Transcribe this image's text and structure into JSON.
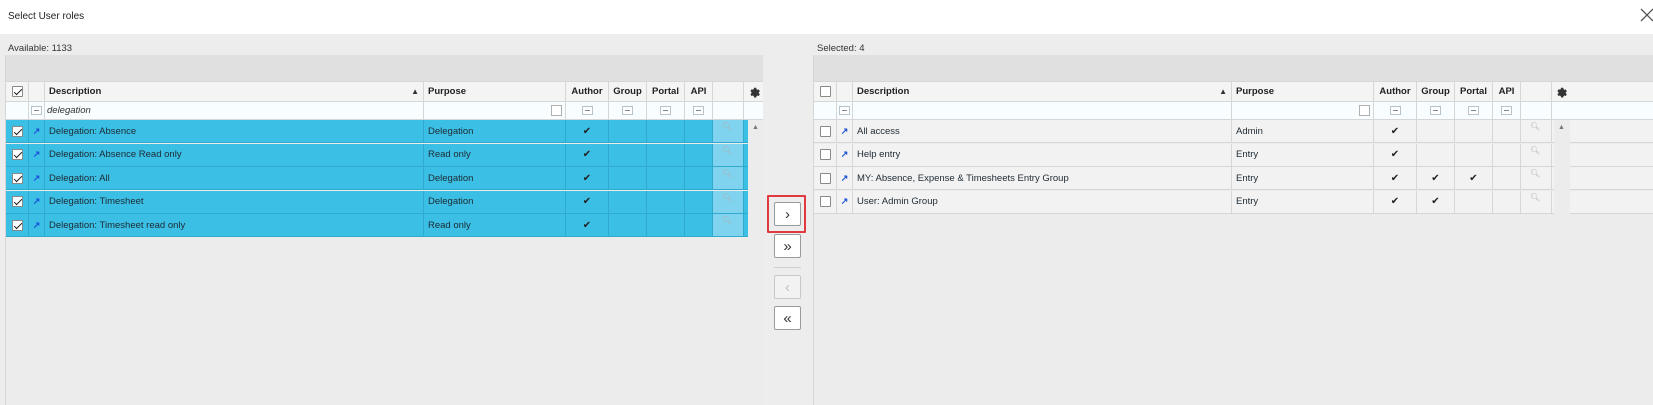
{
  "window": {
    "title": "Select User roles",
    "close_icon": "close-icon"
  },
  "available": {
    "count_label": "Available: 1133",
    "columns": [
      "Description",
      "Purpose",
      "Author",
      "Group",
      "Portal",
      "API"
    ],
    "filter_value": "delegation",
    "rows": [
      {
        "description": "Delegation: Absence",
        "purpose": "Delegation",
        "author": true,
        "group": false,
        "portal": false,
        "api": false
      },
      {
        "description": "Delegation: Absence Read only",
        "purpose": "Read only",
        "author": true,
        "group": false,
        "portal": false,
        "api": false
      },
      {
        "description": "Delegation: All",
        "purpose": "Delegation",
        "author": true,
        "group": false,
        "portal": false,
        "api": false
      },
      {
        "description": "Delegation: Timesheet",
        "purpose": "Delegation",
        "author": true,
        "group": false,
        "portal": false,
        "api": false
      },
      {
        "description": "Delegation: Timesheet read only",
        "purpose": "Read only",
        "author": true,
        "group": false,
        "portal": false,
        "api": false
      }
    ]
  },
  "selected": {
    "count_label": "Selected: 4",
    "columns": [
      "Description",
      "Purpose",
      "Author",
      "Group",
      "Portal",
      "API"
    ],
    "rows": [
      {
        "description": "All access",
        "purpose": "Admin",
        "author": true,
        "group": false,
        "portal": false,
        "api": false
      },
      {
        "description": "Help entry",
        "purpose": "Entry",
        "author": true,
        "group": false,
        "portal": false,
        "api": false
      },
      {
        "description": "MY: Absence, Expense & Timesheets Entry Group",
        "purpose": "Entry",
        "author": true,
        "group": true,
        "portal": true,
        "api": false
      },
      {
        "description": "User: Admin Group",
        "purpose": "Entry",
        "author": true,
        "group": true,
        "portal": false,
        "api": false
      }
    ]
  },
  "transfer": {
    "move_selected": "›",
    "move_all": "»",
    "remove_selected": "‹",
    "remove_all": "«"
  },
  "accent_color": "#3bbfe4",
  "highlight_color": "#e0393e"
}
